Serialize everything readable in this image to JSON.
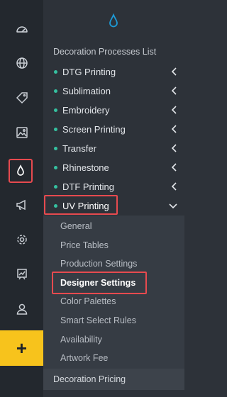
{
  "colors": {
    "rail_bg": "#23282e",
    "panel_bg": "#2d3239",
    "submenu_bg": "#363c44",
    "accent_blue": "#1d9bd7",
    "status_dot": "#35c1a0",
    "highlight_red": "#e74a4f",
    "add_button": "#f7c31c"
  },
  "rail": {
    "items": [
      {
        "icon": "dashboard-gauge-icon"
      },
      {
        "icon": "globe-icon"
      },
      {
        "icon": "tag-icon"
      },
      {
        "icon": "image-icon"
      },
      {
        "icon": "droplet-icon",
        "active": true
      },
      {
        "icon": "megaphone-icon"
      },
      {
        "icon": "gear-icon"
      },
      {
        "icon": "presentation-chart-icon"
      },
      {
        "icon": "user-icon"
      }
    ],
    "add_label": "+"
  },
  "panel": {
    "top_icon": "droplet-icon",
    "section_title": "Decoration Processes List",
    "processes": [
      {
        "label": "DTG Printing",
        "expanded": false
      },
      {
        "label": "Sublimation",
        "expanded": false
      },
      {
        "label": "Embroidery",
        "expanded": false
      },
      {
        "label": "Screen Printing",
        "expanded": false
      },
      {
        "label": "Transfer",
        "expanded": false
      },
      {
        "label": "Rhinestone",
        "expanded": false
      },
      {
        "label": "DTF Printing",
        "expanded": false
      },
      {
        "label": "UV Printing",
        "expanded": true
      }
    ],
    "submenu": [
      {
        "label": "General"
      },
      {
        "label": "Price Tables"
      },
      {
        "label": "Production Settings"
      },
      {
        "label": "Designer Settings",
        "active": true
      },
      {
        "label": "Color Palettes"
      },
      {
        "label": "Smart Select Rules"
      },
      {
        "label": "Availability"
      },
      {
        "label": "Artwork Fee"
      }
    ],
    "bottom_section": "Decoration Pricing"
  }
}
